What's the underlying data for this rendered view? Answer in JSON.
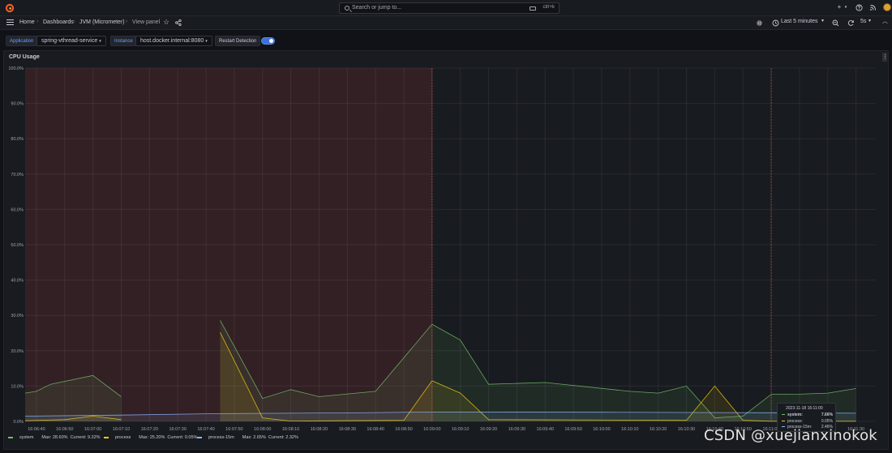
{
  "topbar": {
    "search_placeholder": "Search or jump to...",
    "search_shortcut": "ctrl+k",
    "plus_label": "+"
  },
  "breadcrumbs": [
    "Home",
    "Dashboards",
    "JVM (Micrometer)",
    "View panel"
  ],
  "timepicker": {
    "range_label": "Last 5 minutes",
    "refresh_label": "5s"
  },
  "variables": {
    "application_label": "Application",
    "application_value": "spring-vthread-service",
    "instance_label": "Instance",
    "instance_value": "host.docker.internal:8080",
    "restart_detection_label": "Restart Detection",
    "restart_detection_enabled": true
  },
  "panel": {
    "title": "CPU Usage"
  },
  "tooltip": {
    "time": "2023-11-18 16:11:00",
    "rows": [
      {
        "name": "system:",
        "value": "7.66%",
        "color": "#73bf69",
        "bold": true
      },
      {
        "name": "process:",
        "value": "0.05%",
        "color": "#f2cc0c",
        "bold": false
      },
      {
        "name": "process-15m:",
        "value": "2.46%",
        "color": "#8ab8ff",
        "bold": false
      }
    ]
  },
  "legend": [
    {
      "name": "system",
      "stats": "Max: 28.60%  Current: 9.32%",
      "color": "#73bf69"
    },
    {
      "name": "process",
      "stats": "Max: 25.20%  Current: 0.05%",
      "color": "#f2cc0c"
    },
    {
      "name": "process-15m",
      "stats": "Max: 2.65%  Current: 2.32%",
      "color": "#8ab8ff"
    }
  ],
  "watermark": "CSDN @xuejianxinokok",
  "chart_data": {
    "type": "area",
    "title": "CPU Usage",
    "ylim": [
      0,
      100
    ],
    "y_ticks": [
      "0.0%",
      "10.0%",
      "20.0%",
      "30.0%",
      "40.0%",
      "50.0%",
      "60.0%",
      "70.0%",
      "80.0%",
      "90.0%",
      "100.0%"
    ],
    "x_ticks": [
      "16:06:40",
      "16:06:50",
      "16:07:00",
      "16:07:10",
      "16:07:20",
      "16:07:30",
      "16:07:40",
      "16:07:50",
      "16:08:00",
      "16:08:10",
      "16:08:20",
      "16:08:30",
      "16:08:40",
      "16:08:50",
      "16:09:00",
      "16:09:10",
      "16:09:20",
      "16:09:30",
      "16:09:40",
      "16:09:50",
      "16:10:00",
      "16:10:10",
      "16:10:20",
      "16:10:30",
      "16:10:40",
      "16:10:50",
      "16:11:00",
      "16:11:10",
      "16:11:20",
      "16:11:30"
    ],
    "x_start": "16:06:36",
    "x_end": "16:11:37",
    "restart_region": {
      "from": "16:06:36",
      "to": "16:09:00"
    },
    "annotations": [
      {
        "time": "16:09:00",
        "color": "#e05a5a"
      },
      {
        "time": "16:11:00",
        "color": "#e05a5a"
      }
    ],
    "grid": true,
    "legend_position": "bottom",
    "series": [
      {
        "name": "system",
        "color": "#73bf69",
        "points": [
          [
            "16:06:36",
            8.0
          ],
          [
            "16:06:40",
            8.5
          ],
          [
            "16:06:45",
            10.5
          ],
          [
            "16:07:00",
            13.0
          ],
          [
            "16:07:10",
            7.0
          ],
          [
            "16:07:10",
            null
          ],
          [
            "16:07:45",
            28.6
          ],
          [
            "16:08:00",
            6.5
          ],
          [
            "16:08:10",
            9.0
          ],
          [
            "16:08:20",
            7.0
          ],
          [
            "16:08:40",
            8.5
          ],
          [
            "16:09:00",
            27.5
          ],
          [
            "16:09:10",
            23.0
          ],
          [
            "16:09:20",
            10.5
          ],
          [
            "16:09:40",
            11.0
          ],
          [
            "16:10:10",
            8.5
          ],
          [
            "16:10:20",
            8.0
          ],
          [
            "16:10:30",
            10.0
          ],
          [
            "16:10:40",
            1.0
          ],
          [
            "16:10:50",
            1.5
          ],
          [
            "16:11:00",
            7.66
          ],
          [
            "16:11:10",
            7.7
          ],
          [
            "16:11:20",
            8.0
          ],
          [
            "16:11:30",
            9.32
          ]
        ]
      },
      {
        "name": "process",
        "color": "#f2cc0c",
        "points": [
          [
            "16:06:36",
            0.2
          ],
          [
            "16:06:50",
            0.5
          ],
          [
            "16:07:00",
            1.5
          ],
          [
            "16:07:10",
            0.5
          ],
          [
            "16:07:10",
            null
          ],
          [
            "16:07:45",
            25.2
          ],
          [
            "16:08:00",
            1.0
          ],
          [
            "16:08:10",
            0.1
          ],
          [
            "16:08:50",
            0.3
          ],
          [
            "16:09:00",
            11.5
          ],
          [
            "16:09:10",
            8.0
          ],
          [
            "16:09:20",
            0.5
          ],
          [
            "16:10:30",
            0.3
          ],
          [
            "16:10:40",
            10.0
          ],
          [
            "16:10:50",
            0.3
          ],
          [
            "16:11:00",
            0.05
          ],
          [
            "16:11:30",
            0.05
          ]
        ]
      },
      {
        "name": "process-15m",
        "color": "#8ab8ff",
        "points": [
          [
            "16:06:36",
            1.5
          ],
          [
            "16:07:10",
            1.8
          ],
          [
            "16:07:45",
            2.2
          ],
          [
            "16:08:30",
            2.4
          ],
          [
            "16:09:00",
            2.65
          ],
          [
            "16:10:00",
            2.6
          ],
          [
            "16:11:00",
            2.46
          ],
          [
            "16:11:30",
            2.32
          ]
        ]
      }
    ]
  }
}
